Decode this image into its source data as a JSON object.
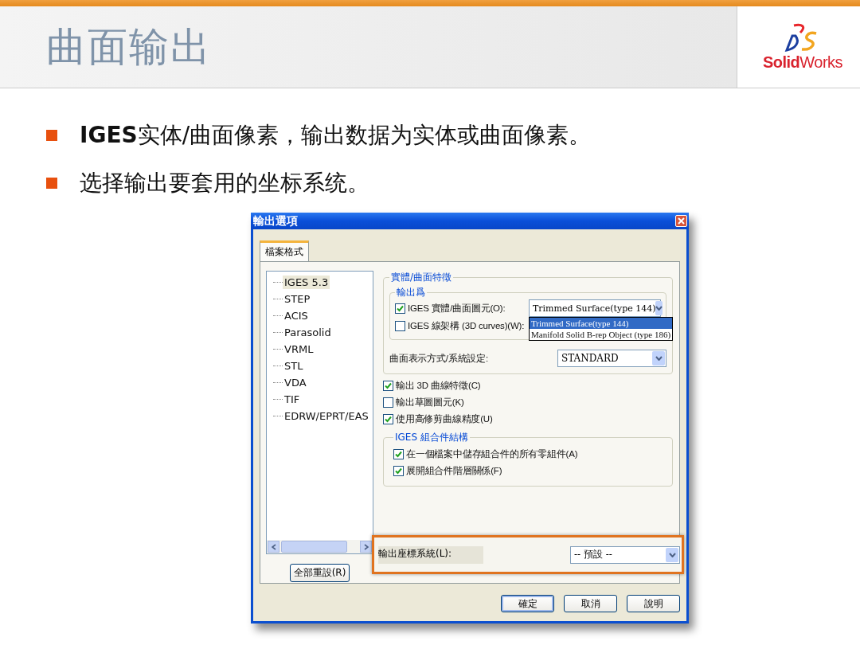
{
  "slide": {
    "title": "曲面输出",
    "logo": {
      "text": "**Solid**Works"
    }
  },
  "bullets": [
    "**IGES**实体/曲面像素，输出数据为实体或曲面像素。",
    "选择输出要套用的坐标系统。"
  ],
  "dialog": {
    "title": "輸出選項",
    "tabs": [
      {
        "label": "檔案格式",
        "selected": true
      }
    ],
    "formats": [
      {
        "label": "IGES 5.3",
        "selected": true
      },
      {
        "label": "STEP",
        "selected": false
      },
      {
        "label": "ACIS",
        "selected": false
      },
      {
        "label": "Parasolid",
        "selected": false
      },
      {
        "label": "VRML",
        "selected": false
      },
      {
        "label": "STL",
        "selected": false
      },
      {
        "label": "VDA",
        "selected": false
      },
      {
        "label": "TIF",
        "selected": false
      },
      {
        "label": "EDRW/EPRT/EAS",
        "selected": false
      }
    ],
    "reset_button": "全部重設(R)",
    "solid_group": {
      "title": "實體/曲面特徵",
      "subgroup": {
        "title": "輸出爲",
        "rows": [
          {
            "label": "IGES 實體/曲面圖元(O):",
            "checked": true,
            "kind": "combo",
            "value": "Trimmed Surface(type 144)"
          },
          {
            "label": "IGES 線架構 (3D curves)(W):",
            "checked": false,
            "kind": "plain"
          }
        ],
        "open_list": [
          {
            "label": "Trimmed Surface(type 144)",
            "selected": true
          },
          {
            "label": "Manifold Solid B-rep Object (type 186)",
            "selected": false
          }
        ]
      },
      "surface_row": {
        "label": "曲面表示方式/系統設定:",
        "value": "STANDARD"
      }
    },
    "checks": [
      {
        "label": "輸出 3D 曲線特徵(C)",
        "checked": true
      },
      {
        "label": "輸出草圖圖元(K)",
        "checked": false
      },
      {
        "label": "使用高修剪曲線精度(U)",
        "checked": true
      }
    ],
    "assembly_group": {
      "title": "IGES 組合件結構",
      "checks": [
        {
          "label": "在一個檔案中儲存組合件的所有零組件(A)",
          "checked": true
        },
        {
          "label": "展開組合件階層關係(F)",
          "checked": true
        }
      ]
    },
    "coord_row": {
      "label": "輸出座標系統(L):",
      "value": "-- 預設 --"
    },
    "buttons": [
      {
        "label": "確定",
        "default": true
      },
      {
        "label": "取消",
        "default": false
      },
      {
        "label": "說明",
        "default": false
      }
    ]
  }
}
